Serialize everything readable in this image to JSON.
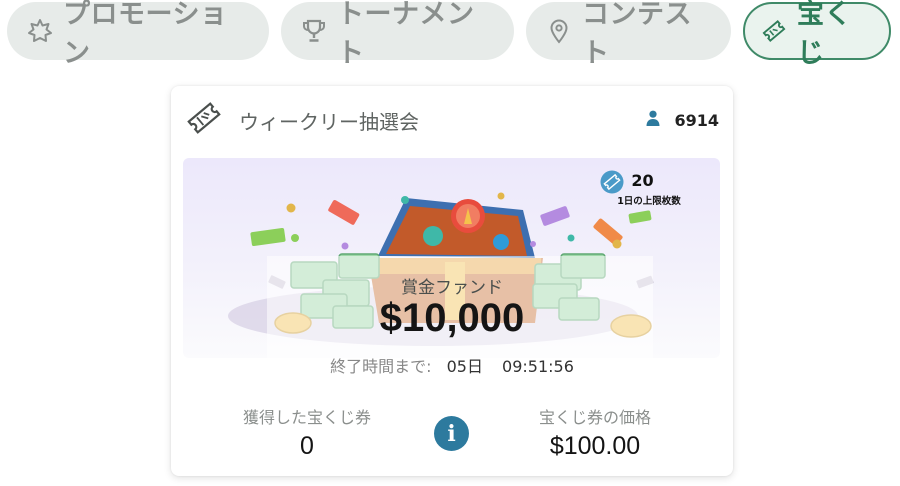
{
  "tabs": [
    {
      "label": "プロモーション",
      "icon": "puzzle-star-icon",
      "active": false
    },
    {
      "label": "トーナメント",
      "icon": "trophy-icon",
      "active": false
    },
    {
      "label": "コンテスト",
      "icon": "map-pin-icon",
      "active": false
    },
    {
      "label": "宝くじ",
      "icon": "ticket-icon",
      "active": true
    }
  ],
  "card": {
    "title": "ウィークリー抽選会",
    "participants": "6914",
    "daily_limit": {
      "count": "20",
      "label": "1日の上限枚数"
    },
    "prize_fund_label": "賞金ファンド",
    "prize_fund_amount": "$10,000",
    "timer": {
      "label": "終了時間まで:",
      "days": "05日",
      "time": "09:51:56"
    },
    "tickets_earned_label": "獲得した宝くじ券",
    "tickets_earned_value": "0",
    "ticket_price_label": "宝くじ券の価格",
    "ticket_price_value": "$100.00",
    "info_symbol": "i"
  },
  "colors": {
    "accent": "#3f8a68",
    "info": "#2d7a9e",
    "tab_bg": "#e7ebe9"
  }
}
